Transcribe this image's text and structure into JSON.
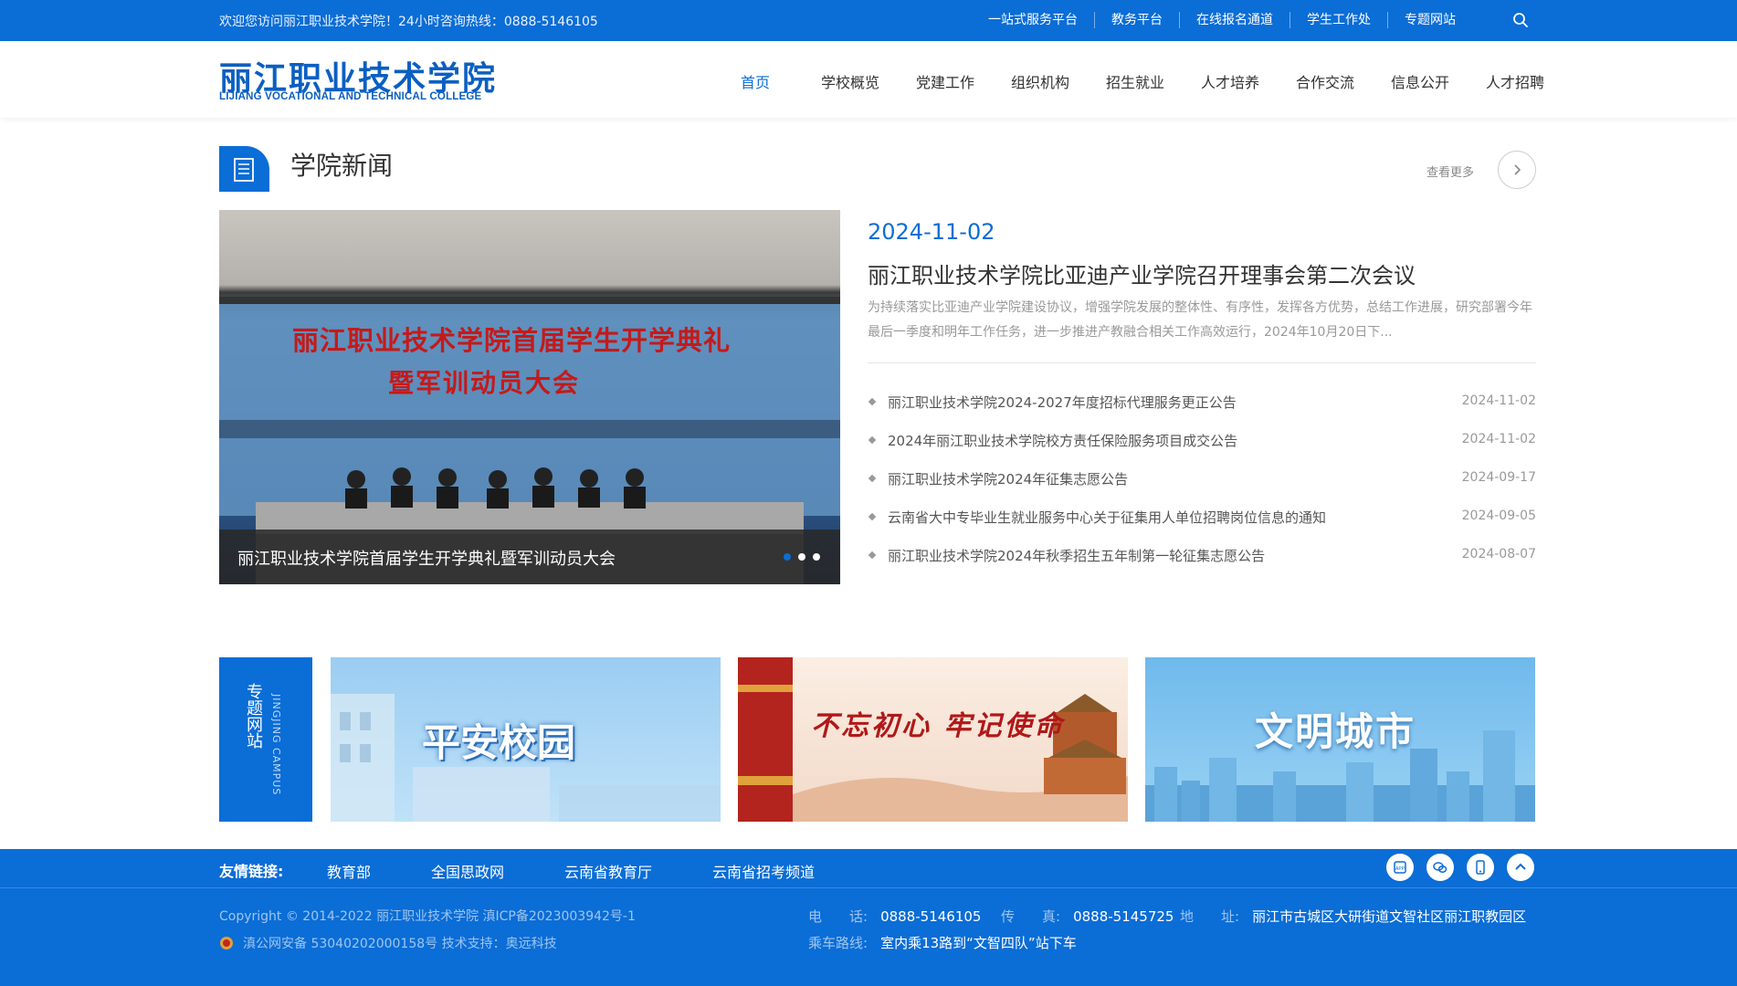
{
  "topbar": {
    "welcome": "欢迎您访问丽江职业技术学院！24小时咨询热线：0888-5146105",
    "links": [
      "一站式服务平台",
      "教务平台",
      "在线报名通道",
      "学生工作处",
      "专题网站"
    ]
  },
  "header": {
    "logo_cn": "丽江职业技术学院",
    "logo_en": "LIJIANG VOCATIONAL AND TECHNICAL COLLEGE",
    "nav": [
      "首页",
      "学校概览",
      "党建工作",
      "组织机构",
      "招生就业",
      "人才培养",
      "合作交流",
      "信息公开",
      "人才招聘"
    ]
  },
  "news_section": {
    "title": "学院新闻",
    "more": "查看更多",
    "slider": {
      "caption": "丽江职业技术学院首届学生开学典礼暨军训动员大会",
      "banner_line1": "丽江职业技术学院首届学生开学典礼",
      "banner_line2": "暨军训动员大会"
    },
    "featured": {
      "date": "2024-11-02",
      "title": "丽江职业技术学院比亚迪产业学院召开理事会第二次会议",
      "summary": "为持续落实比亚迪产业学院建设协议，增强学院发展的整体性、有序性，发挥各方优势，总结工作进展，研究部署今年最后一季度和明年工作任务，进一步推进产教融合相关工作高效运行，2024年10月20日下..."
    },
    "list": [
      {
        "title": "丽江职业技术学院2024-2027年度招标代理服务更正公告",
        "date": "2024-11-02"
      },
      {
        "title": "2024年丽江职业技术学院校方责任保险服务项目成交公告",
        "date": "2024-11-02"
      },
      {
        "title": "丽江职业技术学院2024年征集志愿公告",
        "date": "2024-09-17"
      },
      {
        "title": "云南省大中专毕业生就业服务中心关于征集用人单位招聘岗位信息的通知",
        "date": "2024-09-05"
      },
      {
        "title": "丽江职业技术学院2024年秋季招生五年制第一轮征集志愿公告",
        "date": "2024-08-07"
      }
    ]
  },
  "special": {
    "label_cn": "专题网站",
    "label_en": "JINGJING CAMPUS",
    "cards": [
      "平安校园",
      "不忘初心 牢记使命",
      "文明城市"
    ]
  },
  "footer": {
    "friend_label": "友情链接:",
    "friend_links": [
      "教育部",
      "全国思政网",
      "云南省教育厅",
      "云南省招考频道"
    ],
    "copyright": "Copyright © 2014-2022 丽江职业技术学院 滇ICP备2023003942号-1",
    "police": "滇公网安备 53040202000158号   技术支持：奥远科技",
    "tel_label": "电　　话:",
    "tel": "0888-5146105",
    "fax_label": "传　　真:",
    "fax": "0888-5145725",
    "addr_label": "地　　址:",
    "addr": "丽江市古城区大研街道文智社区丽江职教园区",
    "bus_label": "乘车路线:",
    "bus": "室内乘13路到“文智四队”站下车"
  },
  "colors": {
    "brand": "#0b6dd6"
  }
}
